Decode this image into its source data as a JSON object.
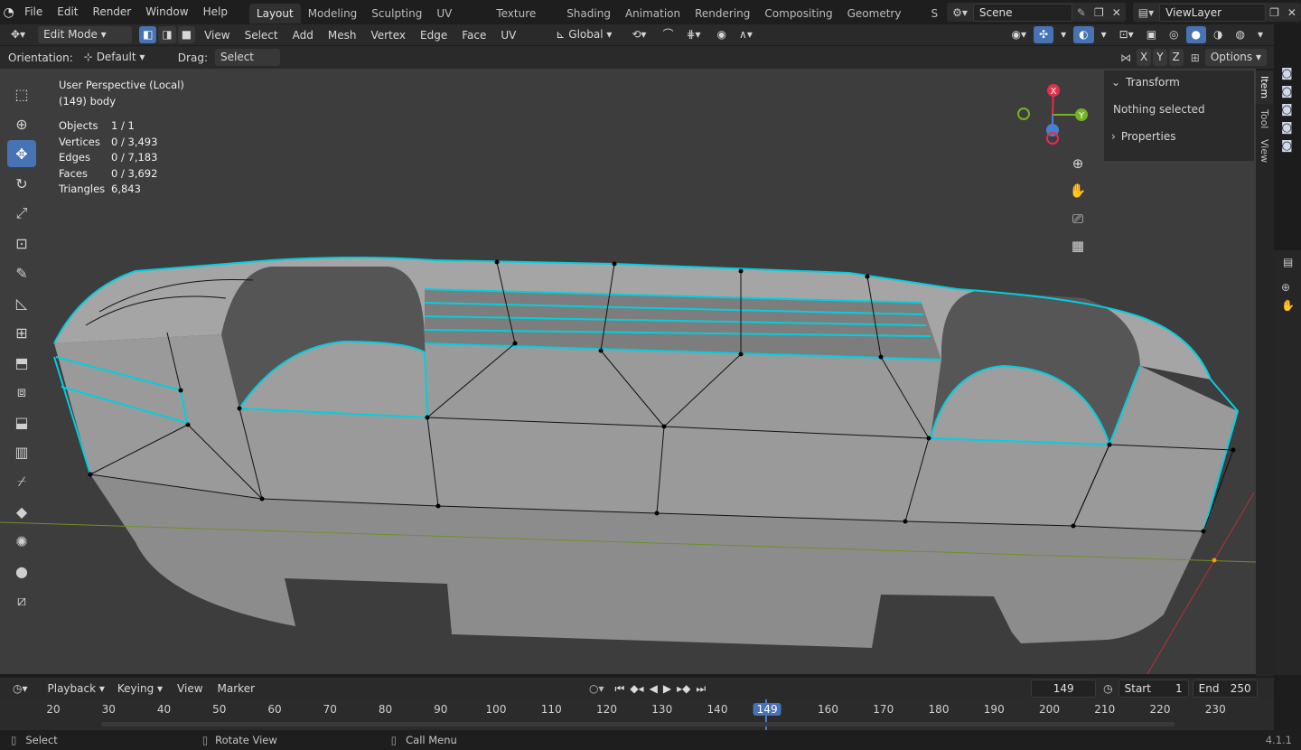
{
  "topbar": {
    "menus": [
      "File",
      "Edit",
      "Render",
      "Window",
      "Help"
    ],
    "workspaces": [
      "Layout",
      "Modeling",
      "Sculpting",
      "UV Editing",
      "Texture Paint",
      "Shading",
      "Animation",
      "Rendering",
      "Compositing",
      "Geometry Nodes",
      "S"
    ],
    "active_workspace": "Layout",
    "scene": "Scene",
    "view_layer": "ViewLayer"
  },
  "header": {
    "mode": "Edit Mode",
    "menus": [
      "View",
      "Select",
      "Add",
      "Mesh",
      "Vertex",
      "Edge",
      "Face",
      "UV"
    ],
    "transform_orientation": "Global"
  },
  "tool_settings": {
    "orientation_label": "Orientation:",
    "orientation_value": "Default",
    "drag_label": "Drag:",
    "drag_value": "Select Box",
    "axes": [
      "X",
      "Y",
      "Z"
    ],
    "options": "Options"
  },
  "viewport": {
    "view_name": "User Perspective (Local)",
    "object_name": "(149) body",
    "stats": [
      {
        "label": "Objects",
        "value": "1 / 1"
      },
      {
        "label": "Vertices",
        "value": "0 / 3,493"
      },
      {
        "label": "Edges",
        "value": "0 / 7,183"
      },
      {
        "label": "Faces",
        "value": "0 / 3,692"
      },
      {
        "label": "Triangles",
        "value": "6,843"
      }
    ],
    "gizmo": {
      "x": "X",
      "y": "Y"
    }
  },
  "n_panel": {
    "transform_header": "Transform",
    "transform_msg": "Nothing selected",
    "properties_header": "Properties",
    "tabs": [
      "Item",
      "Tool",
      "View"
    ]
  },
  "timeline": {
    "menus": [
      "Playback",
      "Keying",
      "View",
      "Marker"
    ],
    "current_frame": "149",
    "start_label": "Start",
    "start": "1",
    "end_label": "End",
    "end": "250",
    "ticks": [
      "20",
      "30",
      "40",
      "50",
      "60",
      "70",
      "80",
      "90",
      "100",
      "110",
      "120",
      "130",
      "140",
      "149",
      "160",
      "170",
      "180",
      "190",
      "200",
      "210",
      "220",
      "230"
    ]
  },
  "status": {
    "select": "Select",
    "rotate": "Rotate View",
    "call_menu": "Call Menu",
    "version": "4.1.1"
  },
  "colors": {
    "accent": "#4772b3",
    "edge": "#00d0e0",
    "bg": "#3d3d3d"
  }
}
